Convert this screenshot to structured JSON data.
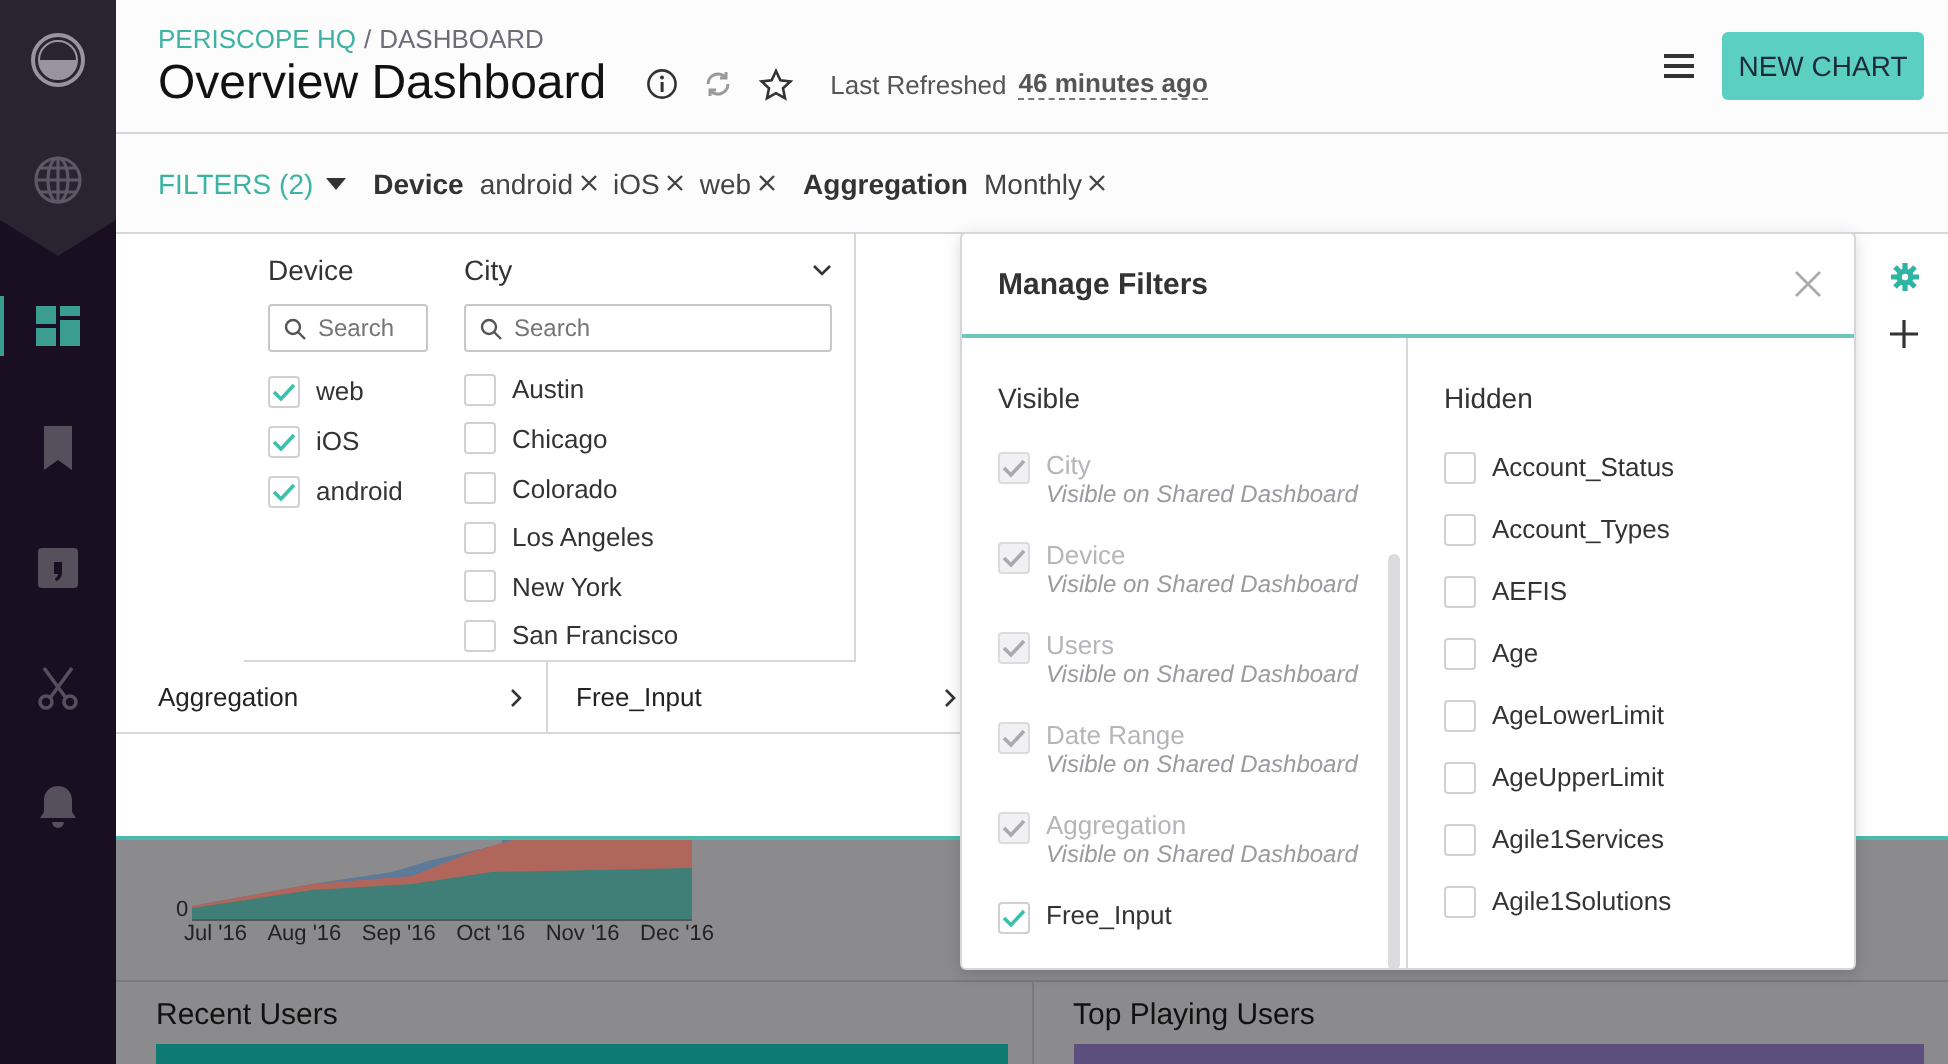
{
  "sidebar": {
    "items": [
      {
        "kind": "logo",
        "selected": false
      },
      {
        "kind": "globe",
        "selected": false
      },
      {
        "kind": "dashboards",
        "selected": true
      },
      {
        "kind": "bookmark",
        "selected": false
      },
      {
        "kind": "comma",
        "selected": false
      },
      {
        "kind": "scissors",
        "selected": false
      },
      {
        "kind": "bell",
        "selected": false
      }
    ]
  },
  "header": {
    "org": "PERISCOPE HQ",
    "separator": "/",
    "page": "DASHBOARD",
    "title": "Overview Dashboard",
    "refresh_label": "Last Refreshed",
    "refresh_time": "46 minutes ago",
    "button": "NEW CHART"
  },
  "filter_bar": {
    "label": "FILTERS",
    "count": "(2)",
    "groups": [
      {
        "name": "Device",
        "values": [
          "android",
          "iOS",
          "web"
        ]
      },
      {
        "name": "Aggregation",
        "values": [
          "Monthly"
        ]
      }
    ]
  },
  "filter_panel": {
    "columns": [
      {
        "title": "Device",
        "placeholder": "Search",
        "options": [
          {
            "label": "web",
            "checked": true
          },
          {
            "label": "iOS",
            "checked": true
          },
          {
            "label": "android",
            "checked": true
          }
        ]
      },
      {
        "title": "City",
        "placeholder": "Search",
        "options": [
          {
            "label": "Austin",
            "checked": false
          },
          {
            "label": "Chicago",
            "checked": false
          },
          {
            "label": "Colorado",
            "checked": false
          },
          {
            "label": "Los Angeles",
            "checked": false
          },
          {
            "label": "New York",
            "checked": false
          },
          {
            "label": "San Francisco",
            "checked": false
          }
        ]
      }
    ],
    "collapsed": [
      "Aggregation",
      "Free_Input"
    ]
  },
  "dashboard": {
    "chart": {
      "y_tick": "0",
      "x_labels": [
        "Jul '16",
        "Aug '16",
        "Sep '16",
        "Oct '16",
        "Nov '16",
        "Dec '16"
      ]
    },
    "panels": [
      {
        "title": "Recent Users",
        "color": "#0e7a72"
      },
      {
        "title": "Top Playing Users",
        "color": "#5c4f7e"
      }
    ]
  },
  "modal": {
    "title": "Manage Filters",
    "visible": {
      "heading": "Visible",
      "items": [
        {
          "label": "City",
          "note": "Visible on Shared Dashboard",
          "checked": true,
          "disabled": true
        },
        {
          "label": "Device",
          "note": "Visible on Shared Dashboard",
          "checked": true,
          "disabled": true
        },
        {
          "label": "Users",
          "note": "Visible on Shared Dashboard",
          "checked": true,
          "disabled": true
        },
        {
          "label": "Date Range",
          "note": "Visible on Shared Dashboard",
          "checked": true,
          "disabled": true
        },
        {
          "label": "Aggregation",
          "note": "Visible on Shared Dashboard",
          "checked": true,
          "disabled": true
        },
        {
          "label": "Free_Input",
          "checked": true,
          "disabled": false
        }
      ]
    },
    "hidden": {
      "heading": "Hidden",
      "items": [
        {
          "label": "Account_Status",
          "checked": false
        },
        {
          "label": "Account_Types",
          "checked": false
        },
        {
          "label": "AEFIS",
          "checked": false
        },
        {
          "label": "Age",
          "checked": false
        },
        {
          "label": "AgeLowerLimit",
          "checked": false
        },
        {
          "label": "AgeUpperLimit",
          "checked": false
        },
        {
          "label": "Agile1Services",
          "checked": false
        },
        {
          "label": "Agile1Solutions",
          "checked": false
        }
      ]
    }
  }
}
